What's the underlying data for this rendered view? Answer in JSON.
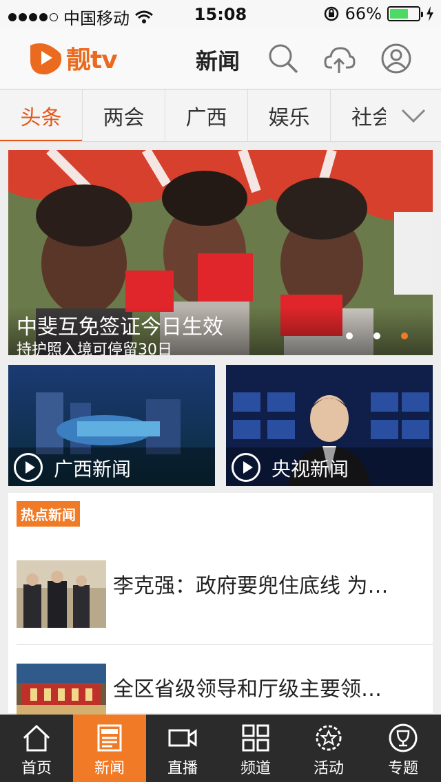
{
  "status_bar": {
    "carrier": "中国移动",
    "time": "15:08",
    "battery": "66%",
    "battery_level": 0.66
  },
  "header": {
    "logo_text": "靓tv",
    "title": "新闻"
  },
  "tabs": [
    {
      "label": "头条",
      "active": true
    },
    {
      "label": "两会"
    },
    {
      "label": "广西"
    },
    {
      "label": "娱乐"
    },
    {
      "label": "社会"
    }
  ],
  "hero": {
    "title": "中斐互免签证今日生效",
    "subtitle": "持护照入境可停留30日",
    "pages": 3,
    "active_page": 3
  },
  "video_cards": [
    {
      "label": "广西新闻"
    },
    {
      "label": "央视新闻"
    }
  ],
  "hot": {
    "badge": "热点新闻",
    "items": [
      {
        "title": "李克强：政府要兜住底线 为…"
      },
      {
        "title": "全区省级领导和厅级主要领…"
      }
    ]
  },
  "tabbar": [
    {
      "label": "首页",
      "icon": "home-icon"
    },
    {
      "label": "新闻",
      "icon": "news-icon",
      "active": true
    },
    {
      "label": "直播",
      "icon": "video-camera-icon"
    },
    {
      "label": "频道",
      "icon": "grid-icon"
    },
    {
      "label": "活动",
      "icon": "star-badge-icon"
    },
    {
      "label": "专题",
      "icon": "trophy-icon"
    }
  ],
  "colors": {
    "accent": "#f07a26",
    "active_tab_text": "#e4571a",
    "tabbar_bg": "#2b2b2b"
  }
}
